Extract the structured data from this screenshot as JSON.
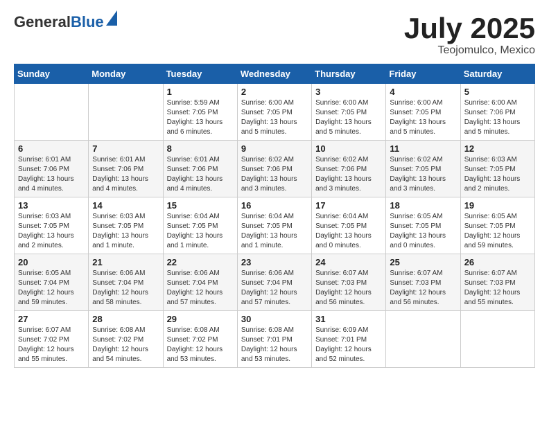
{
  "header": {
    "logo_general": "General",
    "logo_blue": "Blue",
    "month_title": "July 2025",
    "location": "Teojomulco, Mexico"
  },
  "weekdays": [
    "Sunday",
    "Monday",
    "Tuesday",
    "Wednesday",
    "Thursday",
    "Friday",
    "Saturday"
  ],
  "weeks": [
    [
      {
        "day": "",
        "info": ""
      },
      {
        "day": "",
        "info": ""
      },
      {
        "day": "1",
        "info": "Sunrise: 5:59 AM\nSunset: 7:05 PM\nDaylight: 13 hours and 6 minutes."
      },
      {
        "day": "2",
        "info": "Sunrise: 6:00 AM\nSunset: 7:05 PM\nDaylight: 13 hours and 5 minutes."
      },
      {
        "day": "3",
        "info": "Sunrise: 6:00 AM\nSunset: 7:05 PM\nDaylight: 13 hours and 5 minutes."
      },
      {
        "day": "4",
        "info": "Sunrise: 6:00 AM\nSunset: 7:05 PM\nDaylight: 13 hours and 5 minutes."
      },
      {
        "day": "5",
        "info": "Sunrise: 6:00 AM\nSunset: 7:06 PM\nDaylight: 13 hours and 5 minutes."
      }
    ],
    [
      {
        "day": "6",
        "info": "Sunrise: 6:01 AM\nSunset: 7:06 PM\nDaylight: 13 hours and 4 minutes."
      },
      {
        "day": "7",
        "info": "Sunrise: 6:01 AM\nSunset: 7:06 PM\nDaylight: 13 hours and 4 minutes."
      },
      {
        "day": "8",
        "info": "Sunrise: 6:01 AM\nSunset: 7:06 PM\nDaylight: 13 hours and 4 minutes."
      },
      {
        "day": "9",
        "info": "Sunrise: 6:02 AM\nSunset: 7:06 PM\nDaylight: 13 hours and 3 minutes."
      },
      {
        "day": "10",
        "info": "Sunrise: 6:02 AM\nSunset: 7:06 PM\nDaylight: 13 hours and 3 minutes."
      },
      {
        "day": "11",
        "info": "Sunrise: 6:02 AM\nSunset: 7:05 PM\nDaylight: 13 hours and 3 minutes."
      },
      {
        "day": "12",
        "info": "Sunrise: 6:03 AM\nSunset: 7:05 PM\nDaylight: 13 hours and 2 minutes."
      }
    ],
    [
      {
        "day": "13",
        "info": "Sunrise: 6:03 AM\nSunset: 7:05 PM\nDaylight: 13 hours and 2 minutes."
      },
      {
        "day": "14",
        "info": "Sunrise: 6:03 AM\nSunset: 7:05 PM\nDaylight: 13 hours and 1 minute."
      },
      {
        "day": "15",
        "info": "Sunrise: 6:04 AM\nSunset: 7:05 PM\nDaylight: 13 hours and 1 minute."
      },
      {
        "day": "16",
        "info": "Sunrise: 6:04 AM\nSunset: 7:05 PM\nDaylight: 13 hours and 1 minute."
      },
      {
        "day": "17",
        "info": "Sunrise: 6:04 AM\nSunset: 7:05 PM\nDaylight: 13 hours and 0 minutes."
      },
      {
        "day": "18",
        "info": "Sunrise: 6:05 AM\nSunset: 7:05 PM\nDaylight: 13 hours and 0 minutes."
      },
      {
        "day": "19",
        "info": "Sunrise: 6:05 AM\nSunset: 7:05 PM\nDaylight: 12 hours and 59 minutes."
      }
    ],
    [
      {
        "day": "20",
        "info": "Sunrise: 6:05 AM\nSunset: 7:04 PM\nDaylight: 12 hours and 59 minutes."
      },
      {
        "day": "21",
        "info": "Sunrise: 6:06 AM\nSunset: 7:04 PM\nDaylight: 12 hours and 58 minutes."
      },
      {
        "day": "22",
        "info": "Sunrise: 6:06 AM\nSunset: 7:04 PM\nDaylight: 12 hours and 57 minutes."
      },
      {
        "day": "23",
        "info": "Sunrise: 6:06 AM\nSunset: 7:04 PM\nDaylight: 12 hours and 57 minutes."
      },
      {
        "day": "24",
        "info": "Sunrise: 6:07 AM\nSunset: 7:03 PM\nDaylight: 12 hours and 56 minutes."
      },
      {
        "day": "25",
        "info": "Sunrise: 6:07 AM\nSunset: 7:03 PM\nDaylight: 12 hours and 56 minutes."
      },
      {
        "day": "26",
        "info": "Sunrise: 6:07 AM\nSunset: 7:03 PM\nDaylight: 12 hours and 55 minutes."
      }
    ],
    [
      {
        "day": "27",
        "info": "Sunrise: 6:07 AM\nSunset: 7:02 PM\nDaylight: 12 hours and 55 minutes."
      },
      {
        "day": "28",
        "info": "Sunrise: 6:08 AM\nSunset: 7:02 PM\nDaylight: 12 hours and 54 minutes."
      },
      {
        "day": "29",
        "info": "Sunrise: 6:08 AM\nSunset: 7:02 PM\nDaylight: 12 hours and 53 minutes."
      },
      {
        "day": "30",
        "info": "Sunrise: 6:08 AM\nSunset: 7:01 PM\nDaylight: 12 hours and 53 minutes."
      },
      {
        "day": "31",
        "info": "Sunrise: 6:09 AM\nSunset: 7:01 PM\nDaylight: 12 hours and 52 minutes."
      },
      {
        "day": "",
        "info": ""
      },
      {
        "day": "",
        "info": ""
      }
    ]
  ]
}
